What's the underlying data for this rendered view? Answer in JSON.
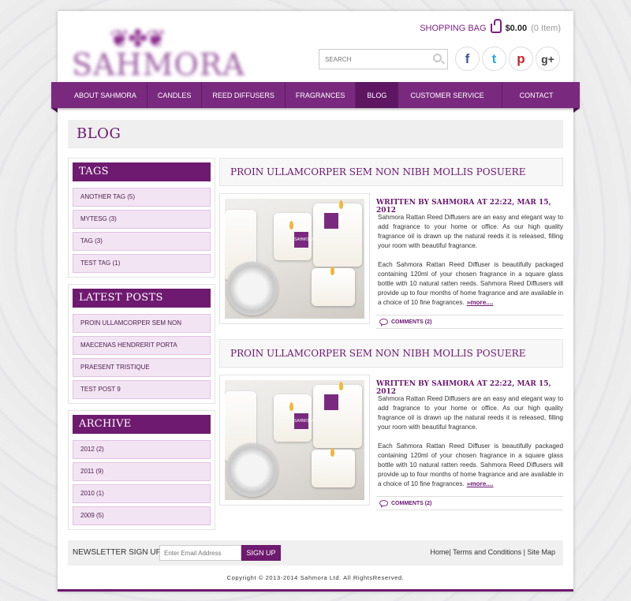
{
  "header": {
    "logo_text": "SAHMORA",
    "bag_label": "SHOPPING BAG",
    "bag_amount": "$0.00",
    "bag_items": "(0 Item)",
    "search_placeholder": "SEARCH",
    "social": [
      {
        "icon": "facebook-icon",
        "glyph": "f",
        "color": "#3b5998"
      },
      {
        "icon": "twitter-icon",
        "glyph": "t",
        "color": "#2aa9e0"
      },
      {
        "icon": "pinterest-icon",
        "glyph": "p",
        "color": "#c8232c"
      },
      {
        "icon": "googleplus-icon",
        "glyph": "g+",
        "color": "#444444"
      }
    ]
  },
  "nav": {
    "items": [
      {
        "label": "ABOUT SAHMORA"
      },
      {
        "label": "CANDLES"
      },
      {
        "label": "REED DIFFUSERS"
      },
      {
        "label": "FRAGRANCES"
      },
      {
        "label": "BLOG",
        "active": true
      },
      {
        "label": "CUSTOMER SERVICE"
      },
      {
        "label": "CONTACT"
      }
    ]
  },
  "page_title": "BLOG",
  "sidebar": {
    "tags": {
      "title": "TAGS",
      "items": [
        "ANOTHER TAG (5)",
        "MYTESG (3)",
        "TAG (3)",
        "TEST TAG (1)"
      ]
    },
    "latest": {
      "title": "LATEST POSTS",
      "items": [
        "PROIN ULLAMCORPER SEM NON",
        "MAECENAS HENDRERIT PORTA",
        "PRAESENT TRISTIQUE",
        "TEST POST 9"
      ]
    },
    "archive": {
      "title": "ARCHIVE",
      "items": [
        "2012 (2)",
        "2011 (9)",
        "2010 (1)",
        "2009 (5)"
      ]
    }
  },
  "posts": [
    {
      "title": "PROIN ULLAMCORPER SEM NON NIBH MOLLIS POSUERE",
      "meta": "WRITTEN BY SAHMORA AT 22:22, MAR 15, 2012",
      "para1": "Sahmora Rattan Reed Diffusers are an easy and elegant way to add fragrance to your home or office. As our high quality fragrance oil is drawn up the natural reeds it is released, filling your room with beautiful fragrance.",
      "para2": "Each Sahmora Rattan Reed Diffuser is beautifully packaged containing 120ml of your chosen fragrance in a square glass bottle with 10 natural ratten reeds.  Sahmora Reed Diffusers will provide up to four months of home fragrance and are available in a choice of 10 fine fragrances.",
      "more": "»more....",
      "comments": "COMMENTS (2)"
    },
    {
      "title": "PROIN ULLAMCORPER SEM NON NIBH MOLLIS POSUERE",
      "meta": "WRITTEN BY SAHMORA AT 22:22, MAR 15, 2012",
      "para1": "Sahmora Rattan Reed Diffusers are an easy and elegant way to add fragrance to your home or office. As our high quality fragrance oil is drawn up the natural reeds it is released, filling your room with beautiful fragrance.",
      "para2": "Each Sahmora Rattan Reed Diffuser is beautifully packaged containing 120ml of your chosen fragrance in a square glass bottle with 10 natural ratten reeds.  Sahmora Reed Diffusers will provide up to four months of home fragrance and are available in a choice of 10 fine fragrances.",
      "more": "»more....",
      "comments": "COMMENTS (2)"
    }
  ],
  "newsletter": {
    "label": "NEWSLETTER SIGN UP",
    "placeholder": "Enter Email Address",
    "button": "SIGN UP"
  },
  "footer": {
    "links": "Home| Terms and Conditions | Site Map",
    "copyright": "Copyright © 2013-2014 Sahmora Ltd. All RightsReserved."
  },
  "colors": {
    "brand": "#6e1a70",
    "nav": "#7a2a7e",
    "tag_bg": "#f3e4f3"
  }
}
